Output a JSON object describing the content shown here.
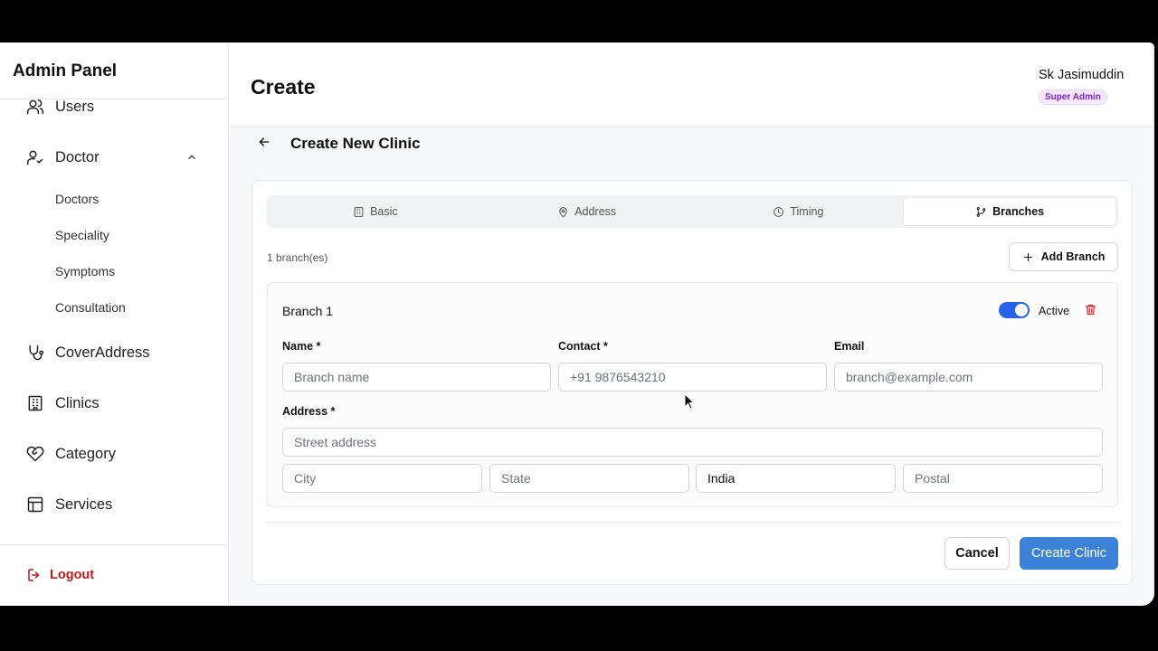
{
  "sidebar": {
    "title": "Admin Panel",
    "items": [
      {
        "label": "Users",
        "icon": "users-icon"
      },
      {
        "label": "Doctor",
        "icon": "user-check-icon"
      },
      {
        "label": "CoverAddress",
        "icon": "stethoscope-icon"
      },
      {
        "label": "Clinics",
        "icon": "building-icon"
      },
      {
        "label": "Category",
        "icon": "heart-handshake-icon"
      },
      {
        "label": "Services",
        "icon": "layout-icon"
      }
    ],
    "sub_items": [
      "Doctors",
      "Speciality",
      "Symptoms",
      "Consultation"
    ],
    "logout_label": "Logout"
  },
  "header": {
    "title": "Create",
    "user_name": "Sk Jasimuddin",
    "role": "Super Admin"
  },
  "page": {
    "subtitle": "Create New Clinic"
  },
  "tabs": [
    {
      "label": "Basic",
      "icon": "building-icon",
      "active": false
    },
    {
      "label": "Address",
      "icon": "map-pin-icon",
      "active": false
    },
    {
      "label": "Timing",
      "icon": "clock-icon",
      "active": false
    },
    {
      "label": "Branches",
      "icon": "git-branch-icon",
      "active": true
    }
  ],
  "branches": {
    "count_label": "1 branch(es)",
    "add_label": "Add Branch",
    "branch": {
      "title": "Branch 1",
      "status_label": "Active",
      "active": true,
      "name_label": "Name *",
      "name_placeholder": "Branch name",
      "contact_label": "Contact *",
      "contact_placeholder": "+91 9876543210",
      "email_label": "Email",
      "email_placeholder": "branch@example.com",
      "address_label": "Address *",
      "street_placeholder": "Street address",
      "city_placeholder": "City",
      "state_placeholder": "State",
      "country_value": "India",
      "postal_placeholder": "Postal"
    }
  },
  "actions": {
    "cancel_label": "Cancel",
    "create_label": "Create Clinic"
  },
  "colors": {
    "primary": "#3b82d6",
    "toggle_on": "#2563eb",
    "danger": "#dc2626",
    "badge_text": "#7e22ce",
    "badge_bg": "#f3e8ff"
  }
}
